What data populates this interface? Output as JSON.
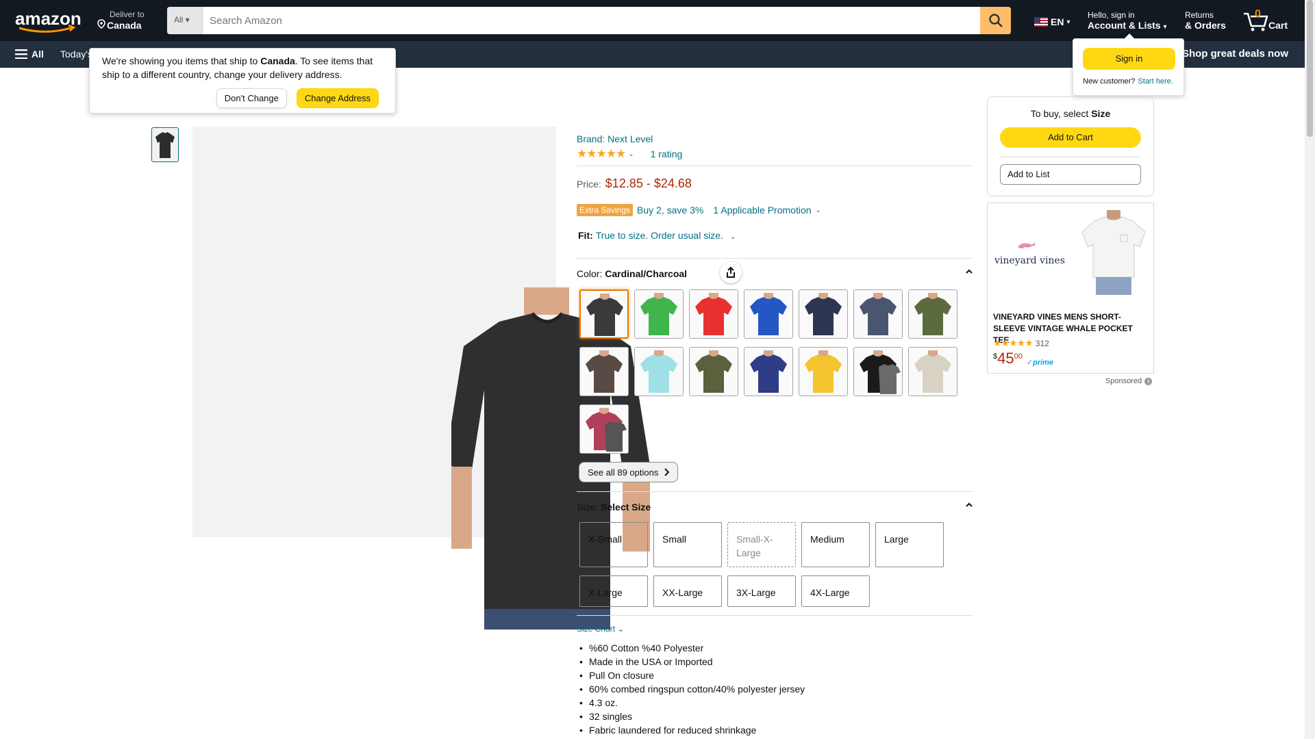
{
  "nav": {
    "deliver_label": "Deliver to",
    "deliver_country": "Canada",
    "search_category": "All",
    "search_placeholder": "Search Amazon",
    "language": "EN",
    "account_greeting": "Hello, sign in",
    "account_label": "Account & Lists",
    "returns_label": "Returns",
    "orders_label": "& Orders",
    "cart_count": "0",
    "cart_label": "Cart",
    "menu_label": "All",
    "todays_deals": "Today's",
    "promo_link": "Shop great deals now"
  },
  "ship_popover": {
    "text_before": "We're showing you items that ship to ",
    "country": "Canada",
    "text_after": ". To see items that ship to a different country, change your delivery address.",
    "dont_change": "Don't Change",
    "change_address": "Change Address"
  },
  "signin_popover": {
    "button": "Sign in",
    "new_customer": "New customer?",
    "start_here": "Start here."
  },
  "product": {
    "brand": "Brand: Next Level",
    "rating_count": "1 rating",
    "price_label": "Price:",
    "price": "$12.85 - $24.68",
    "promo_badge": "Extra Savings",
    "promo_text": "Buy 2, save 3%",
    "promo_applicable": "1 Applicable Promotion",
    "fit_label": "Fit:",
    "fit_text": "True to size. Order usual size.",
    "color_label": "Color:",
    "color_value": "Cardinal/Charcoal",
    "see_all": "See all 89 options",
    "size_label": "Size:",
    "size_value": "Select Size",
    "sizes": [
      "X-Small",
      "Small",
      "Small-X-Large",
      "Medium",
      "Large",
      "X-Large",
      "XX-Large",
      "3X-Large",
      "4X-Large"
    ],
    "size_chart": "Size Chart",
    "bullets": [
      "%60 Cotton %40 Polyester",
      "Made in the USA or Imported",
      "Pull On closure",
      "60% combed ringspun cotton/40% polyester jersey",
      "4.3 oz.",
      "32 singles",
      "Fabric laundered for reduced shrinkage"
    ],
    "swatch_colors": [
      "#3a3a3c",
      "#3fb54c",
      "#e8302f",
      "#2456c4",
      "#2c3650",
      "#4a5670",
      "#5c6b3e",
      "#5a4a44",
      "#9ee0e6",
      "#59613d",
      "#2f3c86",
      "#f4c430",
      "#1a1a1a",
      "#d8d2c4",
      "#b0405a"
    ]
  },
  "buybox": {
    "title_before": "To buy, select ",
    "title_bold": "Size",
    "add_to_cart": "Add to Cart",
    "add_to_list": "Add to List"
  },
  "ad": {
    "brand_logo": "vineyard vines",
    "title": "VINEYARD VINES MENS SHORT-SLEEVE VINTAGE WHALE POCKET TEE",
    "rating_count": "312",
    "price_currency": "$",
    "price_whole": "45",
    "price_fraction": "00",
    "prime": "prime",
    "sponsored": "Sponsored"
  }
}
